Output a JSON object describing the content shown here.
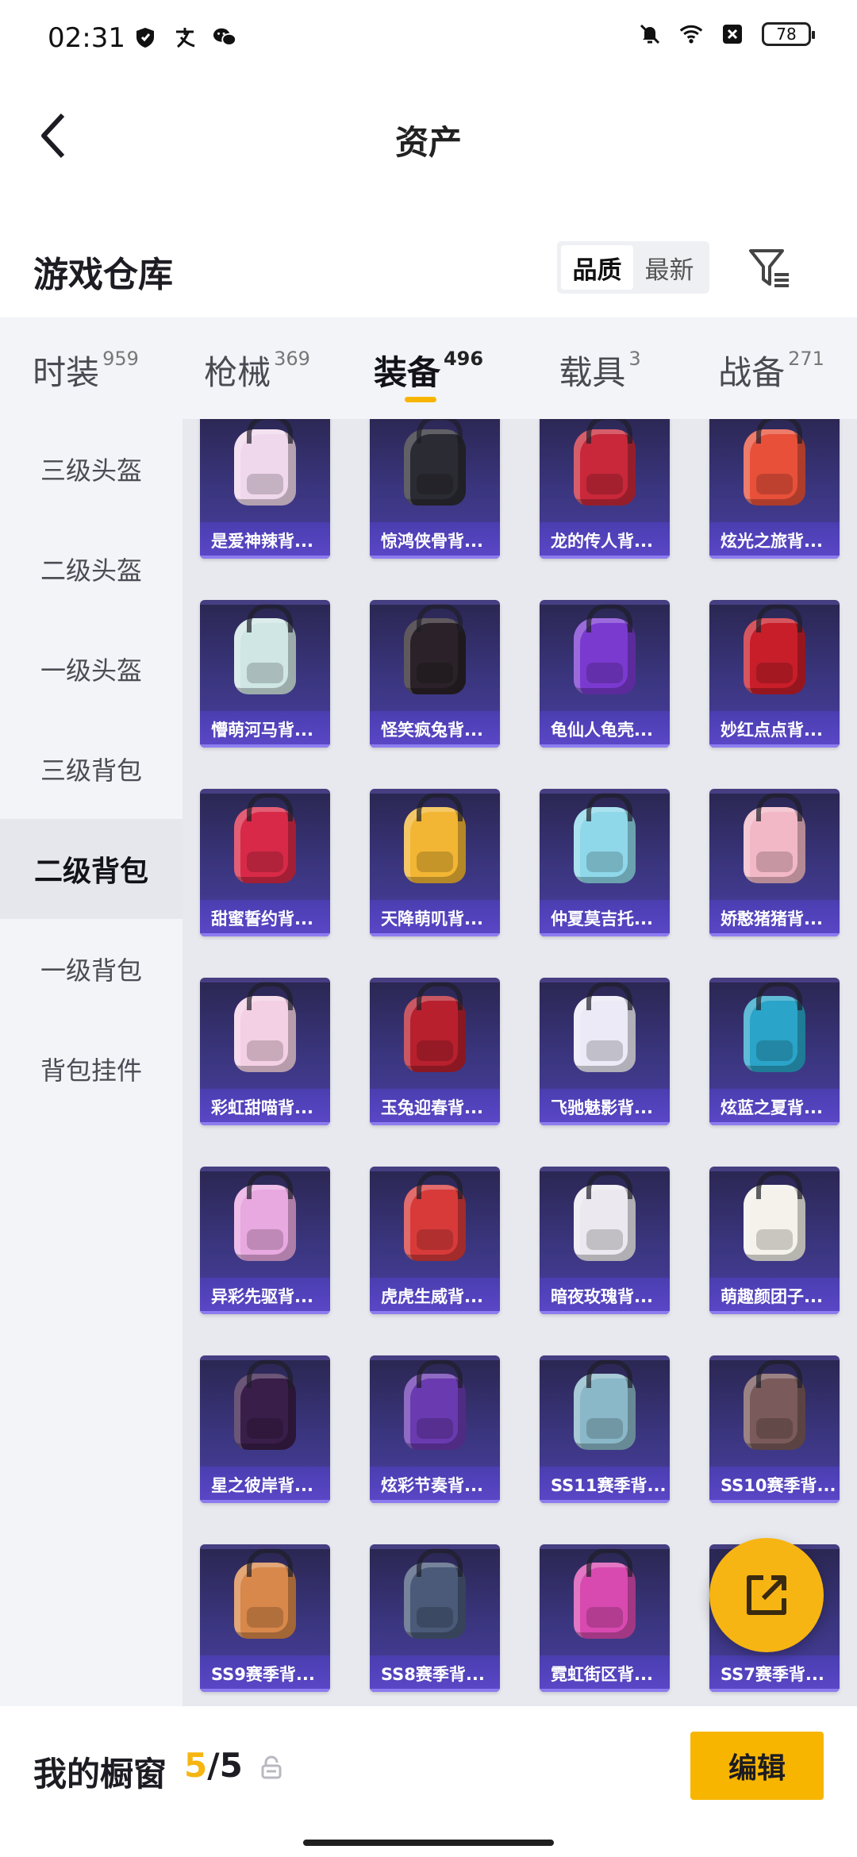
{
  "status_bar": {
    "time": "02:31",
    "battery": "78"
  },
  "nav": {
    "title": "资产"
  },
  "warehouse": {
    "title": "游戏仓库",
    "sort_options": [
      "品质",
      "最新"
    ]
  },
  "tabs": [
    {
      "label": "时装",
      "count": "959"
    },
    {
      "label": "枪械",
      "count": "369"
    },
    {
      "label": "装备",
      "count": "496",
      "active": true
    },
    {
      "label": "载具",
      "count": "3"
    },
    {
      "label": "战备",
      "count": "271"
    }
  ],
  "sidebar": {
    "items": [
      "三级头盔",
      "二级头盔",
      "一级头盔",
      "三级背包",
      "二级背包",
      "一级背包",
      "背包挂件"
    ],
    "active_index": 4
  },
  "items": [
    {
      "name": "是爱神辣背...",
      "color": "#f0d8ec"
    },
    {
      "name": "惊鸿侠骨背...",
      "color": "#2b2b33"
    },
    {
      "name": "龙的传人背...",
      "color": "#c8283a"
    },
    {
      "name": "炫光之旅背...",
      "color": "#e8503a"
    },
    {
      "name": "懵萌河马背...",
      "color": "#cfe6e4"
    },
    {
      "name": "怪笑疯兔背...",
      "color": "#2a2228"
    },
    {
      "name": "龟仙人龟壳...",
      "color": "#7a3ad0"
    },
    {
      "name": "妙红点点背...",
      "color": "#c81e2a"
    },
    {
      "name": "甜蜜誓约背...",
      "color": "#d82a48"
    },
    {
      "name": "天降萌叽背...",
      "color": "#f2b634"
    },
    {
      "name": "仲夏莫吉托...",
      "color": "#8fd8ea"
    },
    {
      "name": "娇憨猪猪背...",
      "color": "#f2b8c6"
    },
    {
      "name": "彩虹甜喵背...",
      "color": "#f4d0e4"
    },
    {
      "name": "玉兔迎春背...",
      "color": "#b8202e"
    },
    {
      "name": "飞驰魅影背...",
      "color": "#eceaf6"
    },
    {
      "name": "炫蓝之夏背...",
      "color": "#2aa4c8"
    },
    {
      "name": "异彩先驱背...",
      "color": "#e8a8e0"
    },
    {
      "name": "虎虎生威背...",
      "color": "#d83a3a"
    },
    {
      "name": "暗夜玫瑰背...",
      "color": "#ece8f0"
    },
    {
      "name": "萌趣颜团子...",
      "color": "#f4f2ea"
    },
    {
      "name": "星之彼岸背...",
      "color": "#3a1e4a"
    },
    {
      "name": "炫彩节奏背...",
      "color": "#6a3ab0"
    },
    {
      "name": "SS11赛季背...",
      "color": "#8ab8c8"
    },
    {
      "name": "SS10赛季背...",
      "color": "#7a5a5a"
    },
    {
      "name": "SS9赛季背...",
      "color": "#d8884a"
    },
    {
      "name": "SS8赛季背...",
      "color": "#4a5a78"
    },
    {
      "name": "霓虹街区背...",
      "color": "#d84ab0"
    },
    {
      "name": "SS7赛季背...",
      "color": "#5a6a8a"
    }
  ],
  "bottom": {
    "label": "我的橱窗",
    "count_used": "5",
    "count_total": "/5",
    "edit_label": "编辑"
  },
  "colors": {
    "accent": "#f7b500",
    "card_bg": "#3b3680",
    "card_label": "#5b47c8"
  }
}
